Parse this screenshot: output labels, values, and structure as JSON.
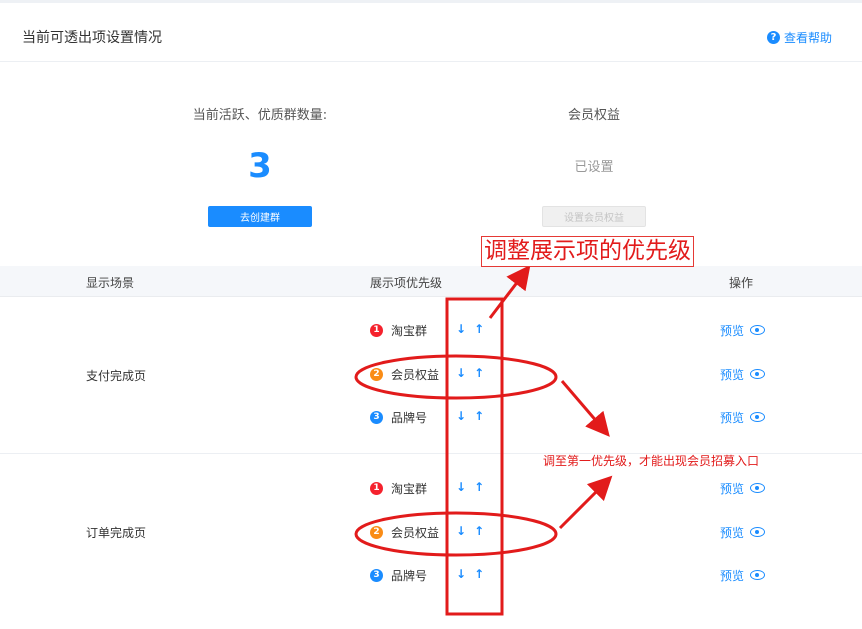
{
  "header": {
    "title": "当前可透出项设置情况",
    "help_label": "查看帮助",
    "help_icon": "question-circle-icon"
  },
  "summary": {
    "groups": {
      "label": "当前活跃、优质群数量:",
      "count": "3",
      "button_label": "去创建群"
    },
    "member": {
      "label": "会员权益",
      "status": "已设置",
      "button_label": "设置会员权益"
    }
  },
  "table": {
    "headers": {
      "scene": "显示场景",
      "priority": "展示项优先级",
      "actions": "操作"
    },
    "sections": [
      {
        "scene": "支付完成页",
        "items": [
          {
            "rank": "1",
            "name": "淘宝群",
            "preview": "预览"
          },
          {
            "rank": "2",
            "name": "会员权益",
            "preview": "预览"
          },
          {
            "rank": "3",
            "name": "品牌号",
            "preview": "预览"
          }
        ]
      },
      {
        "scene": "订单完成页",
        "items": [
          {
            "rank": "1",
            "name": "淘宝群",
            "preview": "预览"
          },
          {
            "rank": "2",
            "name": "会员权益",
            "preview": "预览"
          },
          {
            "rank": "3",
            "name": "品牌号",
            "preview": "预览"
          }
        ]
      }
    ],
    "arrow_down": "↓",
    "arrow_up": "↑"
  },
  "annotations": {
    "title": "调整展示项的优先级",
    "note": "调至第一优先级，才能出现会员招募入口",
    "color": "#e21b1b"
  },
  "colors": {
    "accent": "#1a8cff",
    "rank1": "#f5222d",
    "rank2": "#fa8c16",
    "rank3": "#1a8cff"
  }
}
